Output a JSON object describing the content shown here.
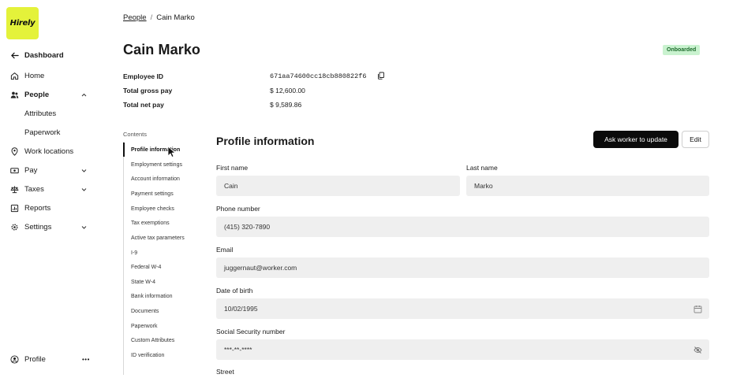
{
  "sidebar": {
    "logo_text": "Hirely",
    "logo_color": "#e4f23a",
    "dashboard": {
      "label": "Dashboard",
      "icon": "arrow-left-icon"
    },
    "items": [
      {
        "label": "Home",
        "icon": "home-icon"
      },
      {
        "label": "People",
        "icon": "people-icon",
        "expanded": true
      },
      {
        "label": "Attributes"
      },
      {
        "label": "Paperwork"
      },
      {
        "label": "Work locations",
        "icon": "location-pin-icon"
      },
      {
        "label": "Pay",
        "icon": "money-icon"
      },
      {
        "label": "Taxes",
        "icon": "scale-icon"
      },
      {
        "label": "Reports",
        "icon": "report-icon"
      },
      {
        "label": "Settings",
        "icon": "gear-icon"
      }
    ],
    "profile": {
      "label": "Profile",
      "icon": "user-circle-icon",
      "more": "•••"
    }
  },
  "breadcrumb": {
    "parent": "People",
    "separator": "/",
    "current": "Cain Marko"
  },
  "header": {
    "title": "Cain Marko",
    "status": "Onboarded",
    "status_color": "#c9f2cf"
  },
  "summary": [
    {
      "label": "Employee ID",
      "value": "671aa74600cc18cb880822f6"
    },
    {
      "label": "Total gross pay",
      "value": "$ 12,600.00"
    },
    {
      "label": "Total net pay",
      "value": "$ 9,589.86"
    }
  ],
  "contents": {
    "title": "Contents",
    "items": [
      "Profile information",
      "Employment settings",
      "Account information",
      "Payment settings",
      "Employee checks",
      "Tax exemptions",
      "Active tax parameters",
      "I-9",
      "Federal W-4",
      "State W-4",
      "Bank information",
      "Documents",
      "Paperwork",
      "Custom Attributes",
      "ID verification"
    ]
  },
  "profile_section": {
    "title": "Profile information",
    "ask_button": "Ask worker to update",
    "edit_button": "Edit",
    "fields": {
      "first_name": {
        "label": "First name",
        "value": "Cain"
      },
      "last_name": {
        "label": "Last name",
        "value": "Marko"
      },
      "phone": {
        "label": "Phone number",
        "value": "(415) 320-7890"
      },
      "email": {
        "label": "Email",
        "value": "juggernaut@worker.com"
      },
      "dob": {
        "label": "Date of birth",
        "value": "10/02/1995"
      },
      "ssn": {
        "label": "Social Security number",
        "value": "***-**-****"
      },
      "street": {
        "label": "Street"
      }
    }
  }
}
